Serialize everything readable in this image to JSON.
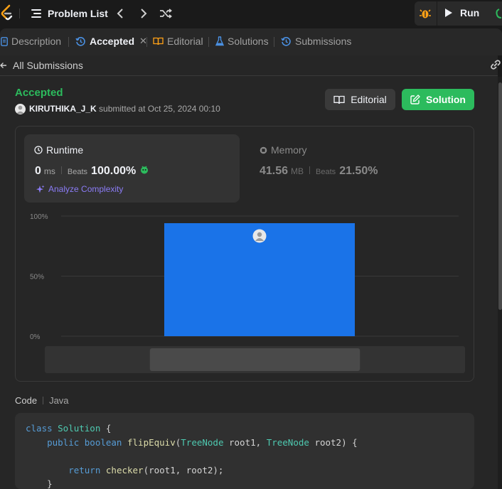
{
  "nav": {
    "problem_list": "Problem List",
    "run": "Run",
    "icons": [
      "leetcode-logo-icon",
      "list-icon",
      "chevron-left-icon",
      "chevron-right-icon",
      "shuffle-icon",
      "debug-icon",
      "play-icon"
    ]
  },
  "tabs": [
    {
      "label": "Description",
      "icon": "document-icon"
    },
    {
      "label": "Accepted",
      "icon": "history-icon",
      "active": true
    },
    {
      "label": "Editorial",
      "icon": "book-icon"
    },
    {
      "label": "Solutions",
      "icon": "flask-icon"
    },
    {
      "label": "Submissions",
      "icon": "history-icon"
    }
  ],
  "back_link": "All Submissions",
  "submission": {
    "status": "Accepted",
    "user": "KIRUTHIKA_J_K",
    "submitted_text": "submitted at Oct 25, 2024 00:10"
  },
  "buttons": {
    "editorial": "Editorial",
    "solution": "Solution"
  },
  "runtime": {
    "title": "Runtime",
    "value": "0",
    "unit": "ms",
    "beats_label": "Beats",
    "beats": "100.00%",
    "analyze": "Analyze Complexity"
  },
  "memory": {
    "title": "Memory",
    "value": "41.56",
    "unit": "MB",
    "beats_label": "Beats",
    "beats": "21.50%"
  },
  "chart_data": {
    "type": "bar",
    "y_ticks": [
      "100%",
      "50%",
      "0%"
    ],
    "ylim": [
      0,
      100
    ],
    "values": [
      100
    ],
    "grid": true,
    "overview_window": [
      0.25,
      0.75
    ],
    "colors": {
      "bar": "#1a73e8",
      "grid": "#3a3a3a"
    }
  },
  "code": {
    "label": "Code",
    "language": "Java",
    "lines": [
      [
        [
          "kw",
          "class "
        ],
        [
          "ty",
          "Solution"
        ],
        [
          "id",
          " {"
        ]
      ],
      [
        [
          "kw",
          "    public boolean "
        ],
        [
          "fn",
          "flipEquiv"
        ],
        [
          "id",
          "("
        ],
        [
          "ty",
          "TreeNode"
        ],
        [
          "id",
          " root1, "
        ],
        [
          "ty",
          "TreeNode"
        ],
        [
          "id",
          " root2) {"
        ]
      ],
      [],
      [
        [
          "kw",
          "        return "
        ],
        [
          "fn",
          "checker"
        ],
        [
          "id",
          "(root1, root2);"
        ]
      ],
      [
        [
          "id",
          "    }"
        ]
      ]
    ]
  },
  "colors": {
    "accent_green": "#2cbb5d",
    "purple": "#8b7cf6",
    "background": "#1a1a1a",
    "panel": "#262626"
  }
}
